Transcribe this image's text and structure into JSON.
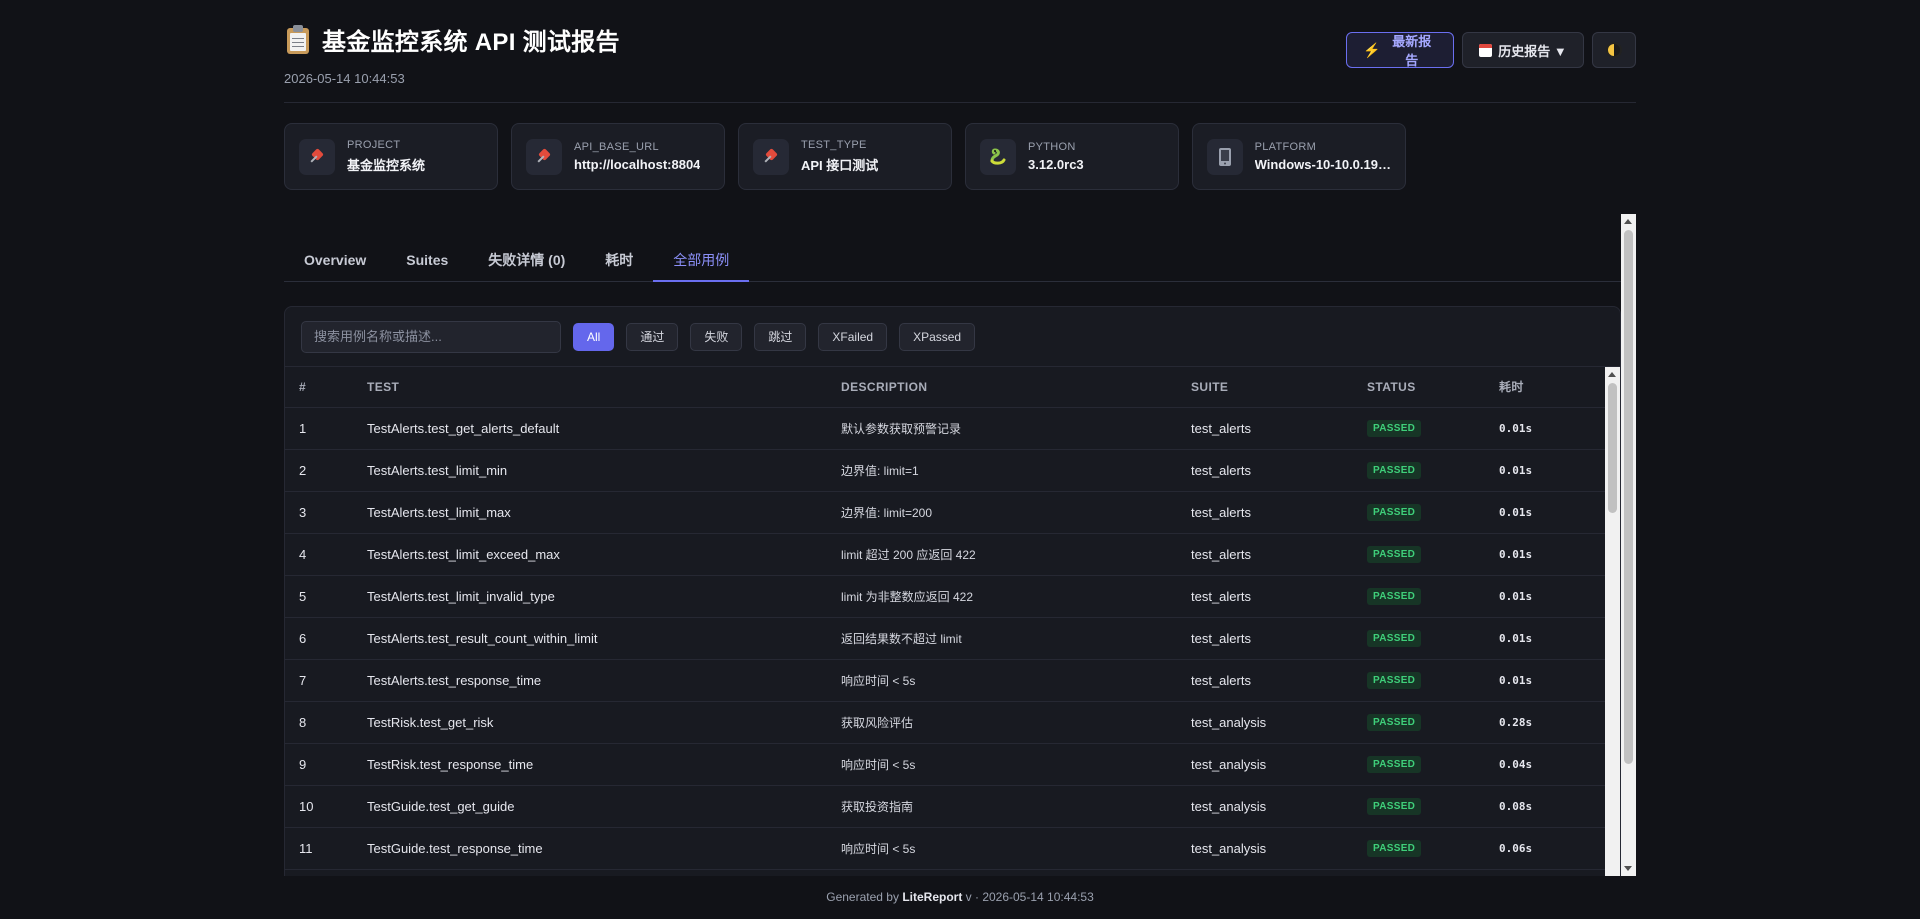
{
  "header": {
    "title": "基金监控系统 API 测试报告",
    "timestamp": "2026-05-14 10:44:53",
    "latest_button": "最新报告",
    "history_button": "历史报告 ▼"
  },
  "info_cards": [
    {
      "label": "PROJECT",
      "value": "基金监控系统",
      "icon": "pin-icon"
    },
    {
      "label": "API_BASE_URL",
      "value": "http://localhost:8804",
      "icon": "pin-icon"
    },
    {
      "label": "TEST_TYPE",
      "value": "API 接口测试",
      "icon": "pin-icon"
    },
    {
      "label": "PYTHON",
      "value": "3.12.0rc3",
      "icon": "python-icon"
    },
    {
      "label": "PLATFORM",
      "value": "Windows-10-10.0.19…",
      "icon": "device-icon"
    }
  ],
  "tabs": [
    "Overview",
    "Suites",
    "失败详情 (0)",
    "耗时",
    "全部用例"
  ],
  "active_tab": "全部用例",
  "filter": {
    "search_placeholder": "搜索用例名称或描述...",
    "chips": [
      "All",
      "通过",
      "失败",
      "跳过",
      "XFailed",
      "XPassed"
    ],
    "active_chip": "All"
  },
  "table": {
    "headers": [
      "#",
      "TEST",
      "DESCRIPTION",
      "SUITE",
      "STATUS",
      "耗时"
    ],
    "rows": [
      [
        "1",
        "TestAlerts.test_get_alerts_default",
        "默认参数获取预警记录",
        "test_alerts",
        "PASSED",
        "0.01s"
      ],
      [
        "2",
        "TestAlerts.test_limit_min",
        "边界值: limit=1",
        "test_alerts",
        "PASSED",
        "0.01s"
      ],
      [
        "3",
        "TestAlerts.test_limit_max",
        "边界值: limit=200",
        "test_alerts",
        "PASSED",
        "0.01s"
      ],
      [
        "4",
        "TestAlerts.test_limit_exceed_max",
        "limit 超过 200 应返回 422",
        "test_alerts",
        "PASSED",
        "0.01s"
      ],
      [
        "5",
        "TestAlerts.test_limit_invalid_type",
        "limit 为非整数应返回 422",
        "test_alerts",
        "PASSED",
        "0.01s"
      ],
      [
        "6",
        "TestAlerts.test_result_count_within_limit",
        "返回结果数不超过 limit",
        "test_alerts",
        "PASSED",
        "0.01s"
      ],
      [
        "7",
        "TestAlerts.test_response_time",
        "响应时间 < 5s",
        "test_alerts",
        "PASSED",
        "0.01s"
      ],
      [
        "8",
        "TestRisk.test_get_risk",
        "获取风险评估",
        "test_analysis",
        "PASSED",
        "0.28s"
      ],
      [
        "9",
        "TestRisk.test_response_time",
        "响应时间 < 5s",
        "test_analysis",
        "PASSED",
        "0.04s"
      ],
      [
        "10",
        "TestGuide.test_get_guide",
        "获取投资指南",
        "test_analysis",
        "PASSED",
        "0.08s"
      ],
      [
        "11",
        "TestGuide.test_response_time",
        "响应时间 < 5s",
        "test_analysis",
        "PASSED",
        "0.06s"
      ]
    ]
  },
  "footer": {
    "prefix": "Generated by",
    "brand": "LiteReport",
    "suffix": "v · 2026-05-14 10:44:53"
  }
}
